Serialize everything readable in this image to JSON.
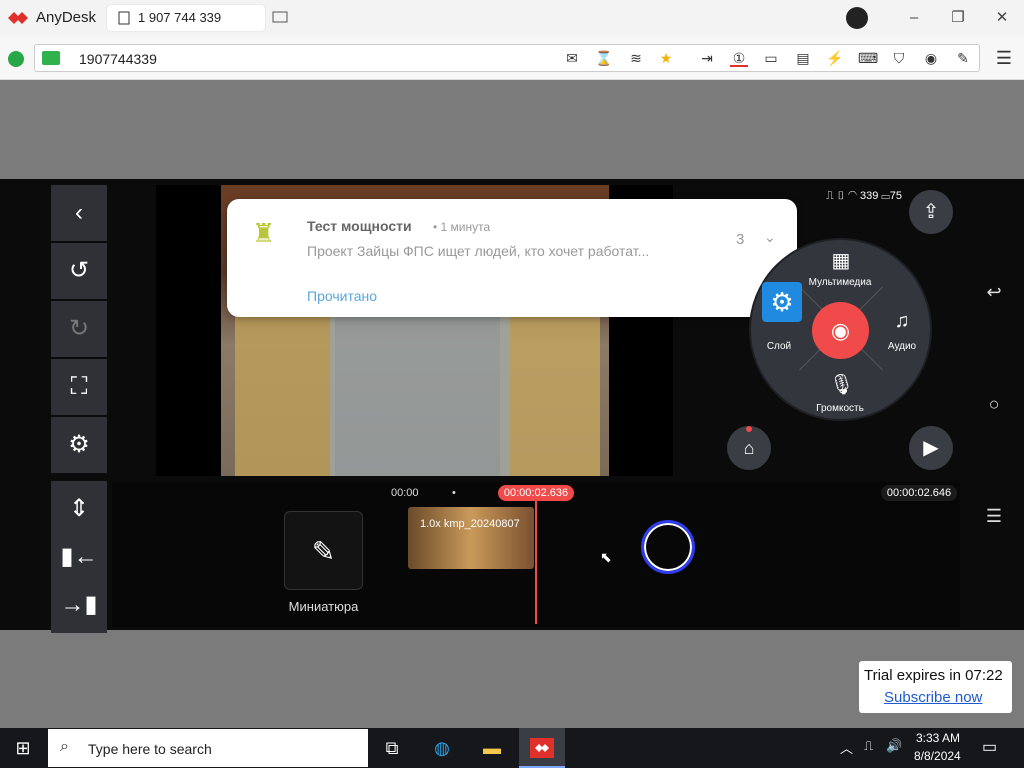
{
  "anydesk": {
    "app_name": "AnyDesk",
    "tab_label": "1 907 744 339",
    "address": "1907744339",
    "trial_text": "Trial expires in 07:22",
    "trial_link": "Subscribe now"
  },
  "notification": {
    "title": "Тест мощности",
    "time": "• 1 минута",
    "body": "Проект Зайцы ФПС ищет людей, кто хочет работат...",
    "count": "3",
    "action": "Прочитано"
  },
  "editor": {
    "wheel": {
      "media": "Мультимедиа",
      "layer": "Слой",
      "audio": "Аудио",
      "volume": "Громкость"
    },
    "status_speed": "339",
    "battery": "75",
    "timeline": {
      "start": "00:00",
      "dot": "•",
      "current": "00:00:02.636",
      "total": "00:00:02.646",
      "clip_label": "1.0x kmp_20240807",
      "thumbnail_label": "Миниатюра"
    }
  },
  "taskbar": {
    "search_placeholder": "Type here to search",
    "time": "3:33 AM",
    "date": "8/8/2024"
  }
}
